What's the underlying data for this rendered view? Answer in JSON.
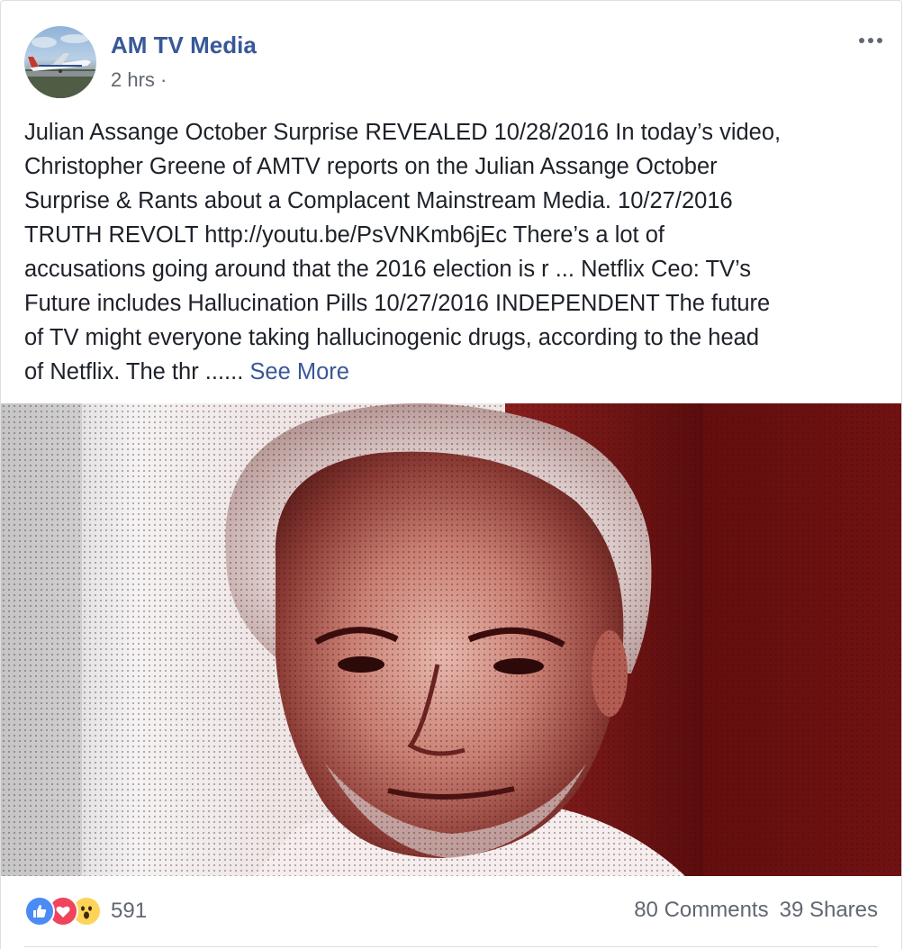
{
  "post": {
    "page_name": "AM TV Media",
    "timestamp": "2 hrs",
    "separator": "·",
    "text_lines": [
      "Julian Assange October Surprise REVEALED 10/28/2016 In today’s video,",
      "Christopher Greene of AMTV reports on the Julian Assange October",
      "Surprise & Rants about a Complacent Mainstream Media. 10/27/2016",
      "TRUTH REVOLT http://youtu.be/PsVNKmb6jEc There’s a lot of",
      "accusations going around that the 2016 election is r ... Netflix Ceo: TV’s",
      "Future includes Hallucination Pills 10/27/2016 INDEPENDENT The future",
      "of TV might everyone taking hallucinogenic drugs, according to the head"
    ],
    "last_line": "of Netflix. The thr ...... ",
    "see_more": "See More"
  },
  "reactions": {
    "icons": [
      "like-icon",
      "love-icon",
      "wow-icon"
    ],
    "count": "591"
  },
  "stats": {
    "comments": "80 Comments",
    "shares": "39 Shares"
  },
  "colors": {
    "link": "#385898",
    "secondary_text": "#616770",
    "like": "#4a8bf5",
    "love": "#f0435c",
    "wow": "#fdd458"
  }
}
